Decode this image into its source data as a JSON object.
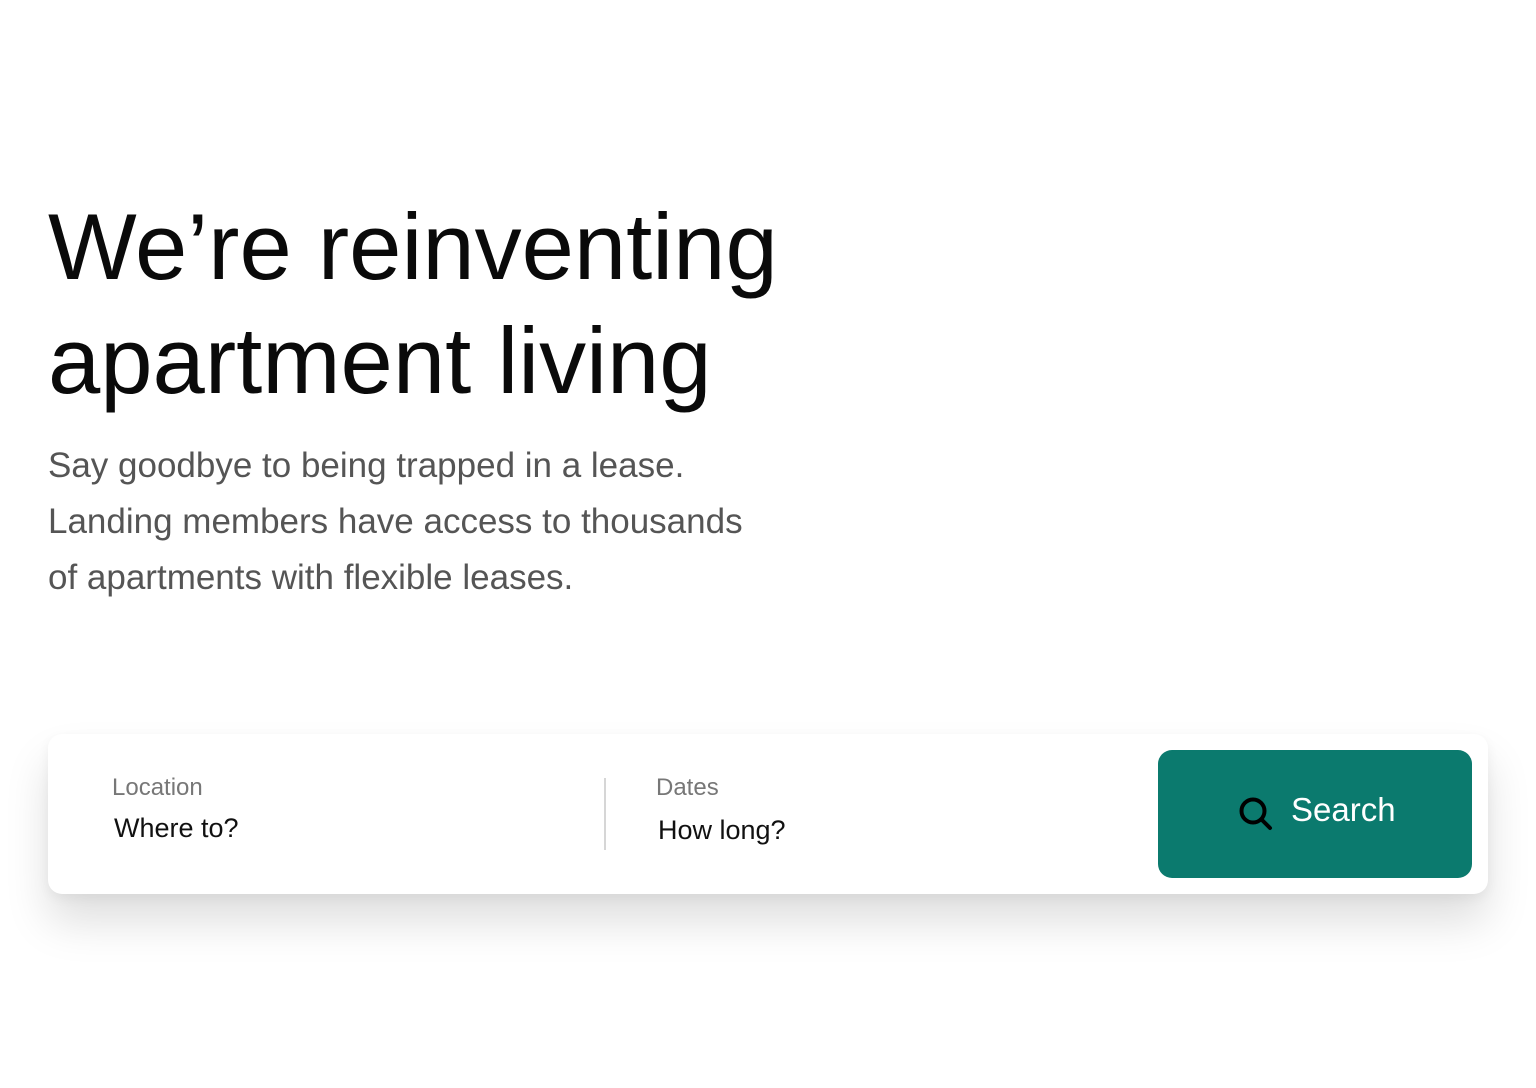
{
  "hero": {
    "title_lines": [
      "We’re reinventing",
      "apartment living"
    ],
    "subtitle_lines": [
      "Say goodbye to being trapped in a lease.",
      "Landing members have access to thousands",
      "of apartments with flexible leases."
    ]
  },
  "search": {
    "location": {
      "label": "Location",
      "placeholder": "Where to?"
    },
    "dates": {
      "label": "Dates",
      "placeholder": "How long?"
    },
    "button_label": "Search",
    "button_icon": "search-icon"
  },
  "colors": {
    "accent": "#0b7a6e",
    "title_text": "#0a0a0a",
    "subtitle_text": "#555555",
    "label_text": "#777777"
  }
}
